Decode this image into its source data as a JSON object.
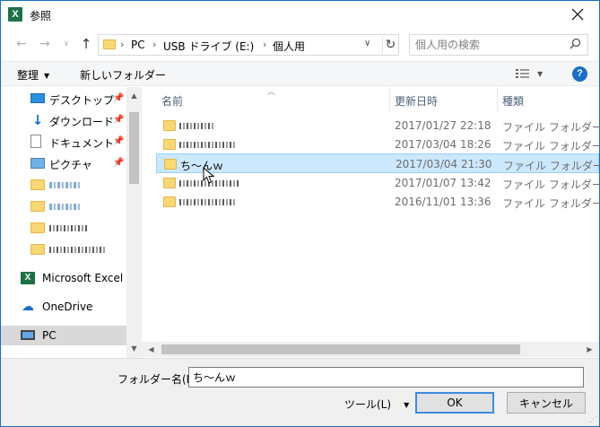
{
  "window": {
    "title": "参照"
  },
  "address": {
    "crumbs": [
      "PC",
      "USB ドライブ (E:)",
      "個人用"
    ]
  },
  "search": {
    "placeholder": "個人用の検索"
  },
  "toolbar": {
    "organize_label": "整理",
    "new_folder_label": "新しいフォルダー"
  },
  "navpane": {
    "quick_access": [
      {
        "label": "デスクトップ",
        "icon": "desktop-icon",
        "pinned": true
      },
      {
        "label": "ダウンロード",
        "icon": "download-icon",
        "pinned": true
      },
      {
        "label": "ドキュメント",
        "icon": "document-icon",
        "pinned": true
      },
      {
        "label": "ピクチャ",
        "icon": "picture-icon",
        "pinned": true
      }
    ],
    "roots": [
      {
        "label": "Microsoft Excel",
        "icon": "excel-icon"
      },
      {
        "label": "OneDrive",
        "icon": "onedrive-icon"
      },
      {
        "label": "PC",
        "icon": "pc-icon"
      }
    ]
  },
  "filelist": {
    "columns": {
      "name": "名前",
      "modified": "更新日時",
      "type": "種類"
    },
    "rows": [
      {
        "name": "",
        "modified": "2017/01/27 22:18",
        "type": "ファイル フォルダー"
      },
      {
        "name": "",
        "modified": "2017/03/04 18:26",
        "type": "ファイル フォルダー"
      },
      {
        "name": "ち～んｗ",
        "modified": "2017/03/04 21:30",
        "type": "ファイル フォルダー"
      },
      {
        "name": "",
        "modified": "2017/01/07 13:42",
        "type": "ファイル フォルダー"
      },
      {
        "name": "",
        "modified": "2016/11/01 13:36",
        "type": "ファイル フォルダー"
      }
    ]
  },
  "footer": {
    "folder_name_label": "フォルダー名(N):",
    "folder_name_value": "ち～んｗ",
    "tools_label": "ツール(L)",
    "ok_label": "OK",
    "cancel_label": "キャンセル"
  }
}
